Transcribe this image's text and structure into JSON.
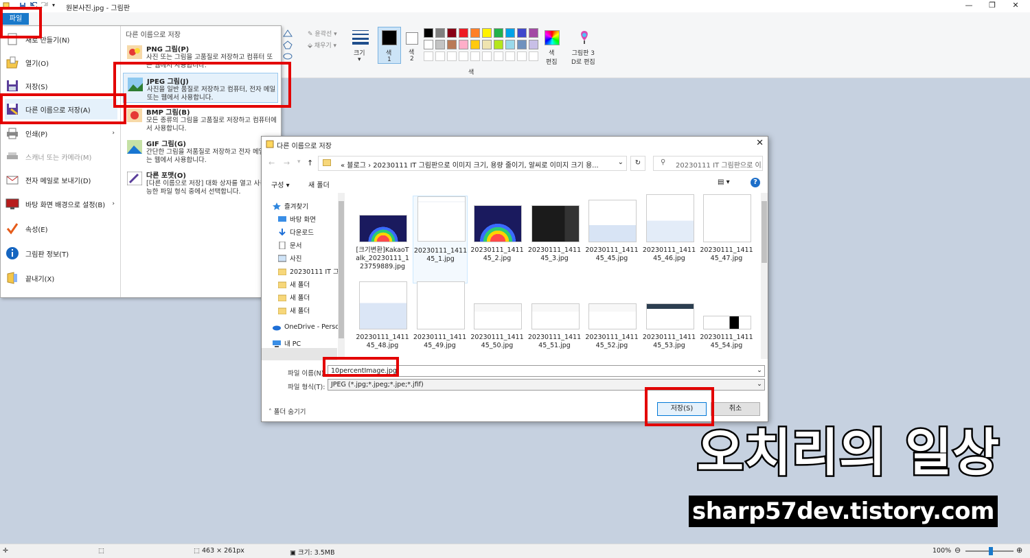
{
  "window": {
    "title": "원본사진.jpg - 그림판",
    "minimize": "—",
    "restore": "❐",
    "close": "✕"
  },
  "ribbon": {
    "file_tab": "파일",
    "outline_label": "윤곽선",
    "fill_label": "채우기",
    "size_label": "크기",
    "color1_label": "색",
    "color1_num": "1",
    "color2_label": "색",
    "color2_num": "2",
    "colors_group": "색",
    "edit_colors": "색 편집",
    "edit_colors_1": "색",
    "edit_colors_2": "편집",
    "paint3d_1": "그림판 3",
    "paint3d_2": "D로 편집",
    "palette": [
      "#000000",
      "#7f7f7f",
      "#880015",
      "#ed1c24",
      "#ff7f27",
      "#fff200",
      "#22b14c",
      "#00a2e8",
      "#3f48cc",
      "#a349a4",
      "#ffffff",
      "#c3c3c3",
      "#b97a57",
      "#ffaec9",
      "#ffc90e",
      "#efe4b0",
      "#b5e61d",
      "#99d9ea",
      "#7092be",
      "#c8bfe7"
    ]
  },
  "file_menu": {
    "items": [
      {
        "label": "새로 만들기(N)",
        "icon": "new-file-icon"
      },
      {
        "label": "열기(O)",
        "icon": "open-folder-icon"
      },
      {
        "label": "저장(S)",
        "icon": "save-disk-icon"
      },
      {
        "label": "다른 이름으로 저장(A)",
        "icon": "save-as-icon"
      },
      {
        "label": "인쇄(P)",
        "icon": "printer-icon"
      },
      {
        "label": "스캐너 또는 카메라(M)",
        "icon": "scanner-icon"
      },
      {
        "label": "전자 메일로 보내기(D)",
        "icon": "email-icon"
      },
      {
        "label": "바탕 화면 배경으로 설정(B)",
        "icon": "desktop-icon"
      },
      {
        "label": "속성(E)",
        "icon": "checkmark-icon"
      },
      {
        "label": "그림판 정보(T)",
        "icon": "info-icon"
      },
      {
        "label": "끝내기(X)",
        "icon": "exit-icon"
      }
    ],
    "submenu_title": "다른 이름으로 저장",
    "submenu": [
      {
        "title": "PNG 그림(P)",
        "desc": "사진 또는 그림을 고품질로 저장하고 컴퓨터 또는 웹에서 사용합니다."
      },
      {
        "title": "JPEG 그림(J)",
        "desc": "사진을 일반 품질로 저장하고 컴퓨터, 전자 메일 또는 웹에서 사용합니다."
      },
      {
        "title": "BMP 그림(B)",
        "desc": "모든 종류의 그림을 고품질로 저장하고 컴퓨터에서 사용합니다."
      },
      {
        "title": "GIF 그림(G)",
        "desc": "간단한 그림을 저품질로 저장하고 전자 메일 또는 웹에서 사용합니다."
      },
      {
        "title": "다른 포맷(O)",
        "desc": "[다른 이름으로 저장] 대화 상자를 열고 사용 가능한 파일 형식 중에서 선택합니다."
      }
    ]
  },
  "dialog": {
    "title": "다른 이름으로 저장",
    "address": "« 블로그 › 20230111 IT 그림판으로 이미지 크기, 용량 줄이기, 알씨로 이미지 크기 용...",
    "search_placeholder": "20230111 IT 그림판으로 이...",
    "organize": "구성 ▾",
    "new_folder": "새 폴더",
    "nav": [
      {
        "label": "즐겨찾기",
        "icon": "star-icon"
      },
      {
        "label": "바탕 화면",
        "icon": "desktop-folder-icon"
      },
      {
        "label": "다운로드",
        "icon": "download-icon"
      },
      {
        "label": "문서",
        "icon": "documents-icon"
      },
      {
        "label": "사진",
        "icon": "pictures-icon"
      },
      {
        "label": "20230111 IT 그",
        "icon": "folder-icon"
      },
      {
        "label": "새 폴더",
        "icon": "folder-icon"
      },
      {
        "label": "새 폴더",
        "icon": "folder-icon"
      },
      {
        "label": "새 폴더",
        "icon": "folder-icon"
      },
      {
        "label": "OneDrive - Person",
        "icon": "cloud-icon"
      },
      {
        "label": "내 PC",
        "icon": "computer-icon"
      }
    ],
    "files": [
      "[크기변환]KakaoTalk_20230111_123759889.jpg",
      "20230111_141145_1.jpg",
      "20230111_141145_2.jpg",
      "20230111_141145_3.jpg",
      "20230111_141145_45.jpg",
      "20230111_141145_46.jpg",
      "20230111_141145_47.jpg",
      "20230111_141145_48.jpg",
      "20230111_141145_49.jpg",
      "20230111_141145_50.jpg",
      "20230111_141145_51.jpg",
      "20230111_141145_52.jpg",
      "20230111_141145_53.jpg",
      "20230111_141145_54.jpg"
    ],
    "filename_label": "파일 이름(N):",
    "filename_value": "10percentImage.jpg",
    "filetype_label": "파일 형식(T):",
    "filetype_value": "JPEG (*.jpg;*.jpeg;*.jpe;*.jfif)",
    "hide_folders": "폴더 숨기기",
    "save_button": "저장(S)",
    "cancel_button": "취소"
  },
  "status": {
    "dimensions": "463 × 261px",
    "size": "크기: 3.5MB",
    "zoom": "100%"
  },
  "watermark": {
    "title": "오치리의 일상",
    "url": "sharp57dev.tistory.com"
  }
}
